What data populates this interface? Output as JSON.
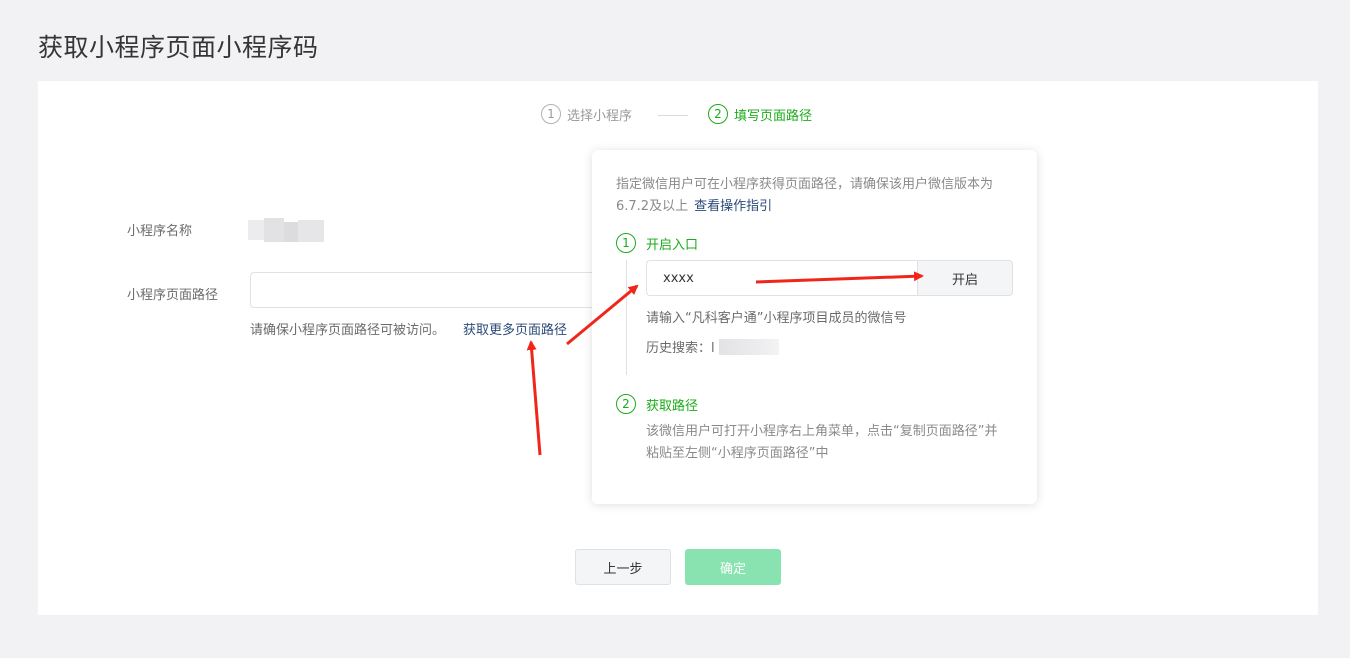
{
  "page": {
    "title": "获取小程序页面小程序码"
  },
  "steps": [
    {
      "num": "1",
      "label": "选择小程序"
    },
    {
      "num": "2",
      "label": "填写页面路径"
    }
  ],
  "form": {
    "name_label": "小程序名称",
    "path_label": "小程序页面路径",
    "path_value": "",
    "path_tip": "请确保小程序页面路径可被访问。",
    "path_link": "获取更多页面路径"
  },
  "popover": {
    "desc": "指定微信用户可在小程序获得页面路径，请确保该用户微信版本为6.7.2及以上",
    "desc_link": "查看操作指引",
    "step1": {
      "num": "1",
      "label": "开启入口"
    },
    "wechat_input_value": "xxxx",
    "open_button": "开启",
    "wechat_tip": "请输入“凡科客户通”小程序项目成员的微信号",
    "history_label": "历史搜索：l",
    "step2": {
      "num": "2",
      "label": "获取路径"
    },
    "step2_desc": "该微信用户可打开小程序右上角菜单，点击“复制页面路径”并粘贴至左侧“小程序页面路径”中"
  },
  "buttons": {
    "prev": "上一步",
    "confirm": "确定"
  },
  "colors": {
    "accent": "#1aad19",
    "confirm_disabled": "#88e3b0",
    "link": "#2b4a7a",
    "annotation_arrow": "#f0261b"
  }
}
